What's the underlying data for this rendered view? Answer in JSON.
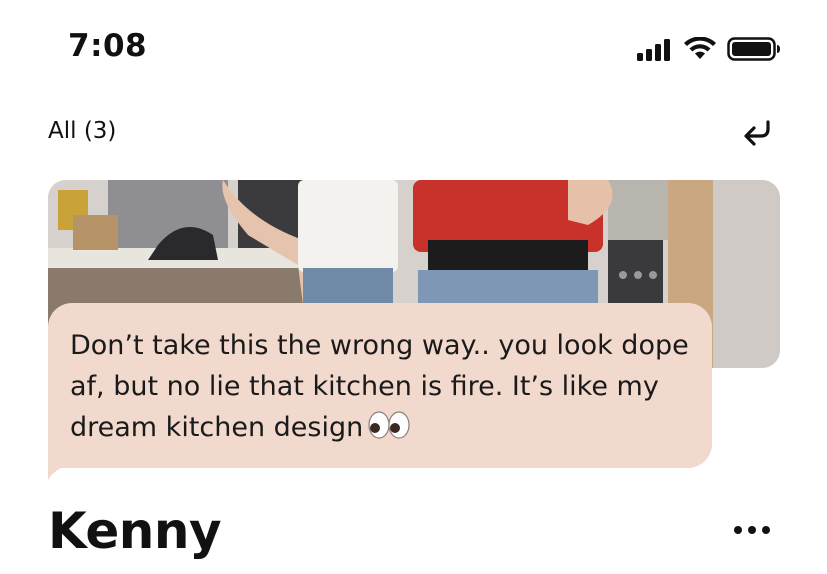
{
  "status_bar": {
    "time": "7:08",
    "icons": [
      "cellular-signal-icon",
      "wifi-icon",
      "battery-icon"
    ]
  },
  "header": {
    "filter_label": "All (3)",
    "reply_icon": "reply-arrow-icon"
  },
  "photo": {
    "description_icon": "photo-thumbnail"
  },
  "message": {
    "text": "Don’t take this the wrong way.. you look dope af, but no lie that kitchen is fire. It’s like my dream kitchen design",
    "emoji": "👀",
    "bubble_color": "#f2d9cd"
  },
  "profile": {
    "name": "Kenny",
    "more_icon": "more-horizontal-icon"
  }
}
